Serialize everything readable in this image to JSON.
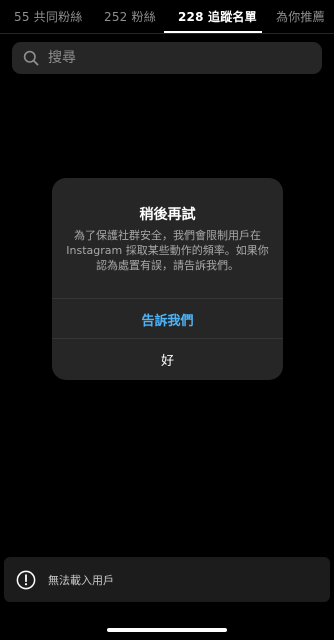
{
  "tabs": [
    {
      "label": "55 共同粉絲",
      "active": false
    },
    {
      "label": "252 粉絲",
      "active": false
    },
    {
      "label": "228 追蹤名單",
      "active": true
    },
    {
      "label": "為你推薦",
      "active": false
    }
  ],
  "search": {
    "placeholder": "搜尋",
    "icon": "search-icon"
  },
  "dialog": {
    "title": "稍後再試",
    "message": "為了保護社群安全，我們會限制用戶在Instagram 採取某些動作的頻率。如果你認為處置有誤，請告訴我們。",
    "primary_button": "告訴我們",
    "secondary_button": "好"
  },
  "toast": {
    "icon": "alert-icon",
    "text": "無法載入用戶"
  },
  "colors": {
    "background": "#000000",
    "dialog_bg": "#262626",
    "link_blue": "#4cb5f9",
    "muted_text": "#8e8e8e"
  }
}
